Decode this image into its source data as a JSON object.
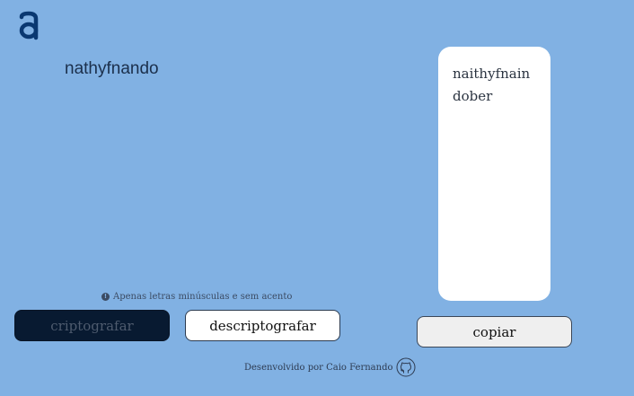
{
  "logo": {
    "icon": "alura-logo-icon",
    "color": "#0a3871"
  },
  "input": {
    "value": "nathyfnando"
  },
  "hint": {
    "icon": "info-icon",
    "text": "Apenas letras minúsculas e sem acento"
  },
  "buttons": {
    "encrypt_label": "criptografar",
    "decrypt_label": "descriptografar"
  },
  "output": {
    "text": "naithyfnaindober"
  },
  "copy": {
    "label": "copiar"
  },
  "footer": {
    "text": "Desenvolvido por Caio Fernando",
    "icon": "github-icon"
  },
  "colors": {
    "background": "#81b1e3",
    "encrypt_button": "#081a31",
    "panel": "#ffffff"
  }
}
